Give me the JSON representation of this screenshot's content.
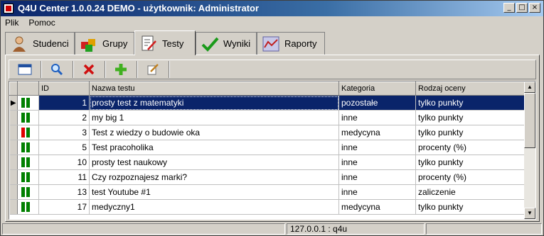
{
  "window": {
    "title": "Q4U Center 1.0.0.24 DEMO - użytkownik: Administrator",
    "minimize": "_",
    "maximize": "□",
    "close": "×"
  },
  "menu": [
    {
      "label": "Plik"
    },
    {
      "label": "Pomoc"
    }
  ],
  "tabs": [
    {
      "label": "Studenci",
      "icon": "student-icon"
    },
    {
      "label": "Grupy",
      "icon": "groups-icon"
    },
    {
      "label": "Testy",
      "icon": "tests-icon",
      "active": true
    },
    {
      "label": "Wyniki",
      "icon": "results-check-icon"
    },
    {
      "label": "Raporty",
      "icon": "reports-chart-icon"
    }
  ],
  "toolbar": [
    {
      "name": "open-button",
      "icon": "window-icon"
    },
    {
      "name": "search-button",
      "icon": "magnifier-icon"
    },
    {
      "name": "delete-button",
      "icon": "red-x-icon"
    },
    {
      "name": "add-button",
      "icon": "green-plus-icon"
    },
    {
      "name": "edit-button",
      "icon": "pencil-note-icon"
    }
  ],
  "grid": {
    "headers": {
      "id": "ID",
      "name": "Nazwa testu",
      "category": "Kategoria",
      "grade_type": "Rodzaj oceny"
    },
    "selected_row": 0,
    "rows": [
      {
        "id": "1",
        "name": "prosty test z matematyki",
        "category": "pozostałe",
        "grade_type": "tylko punkty",
        "status": [
          "#008000",
          "#008000"
        ]
      },
      {
        "id": "2",
        "name": "my big 1",
        "category": "inne",
        "grade_type": "tylko punkty",
        "status": [
          "#008000",
          "#008000"
        ]
      },
      {
        "id": "3",
        "name": "Test z wiedzy o budowie oka",
        "category": "medycyna",
        "grade_type": "tylko punkty",
        "status": [
          "#e00000",
          "#008000"
        ]
      },
      {
        "id": "5",
        "name": "Test pracoholika",
        "category": "inne",
        "grade_type": "procenty (%)",
        "status": [
          "#008000",
          "#008000"
        ]
      },
      {
        "id": "10",
        "name": "prosty test naukowy",
        "category": "inne",
        "grade_type": "tylko punkty",
        "status": [
          "#008000",
          "#008000"
        ]
      },
      {
        "id": "11",
        "name": "Czy rozpoznajesz marki?",
        "category": "inne",
        "grade_type": "procenty (%)",
        "status": [
          "#008000",
          "#008000"
        ]
      },
      {
        "id": "13",
        "name": "test Youtube #1",
        "category": "inne",
        "grade_type": "zaliczenie",
        "status": [
          "#008000",
          "#008000"
        ]
      },
      {
        "id": "17",
        "name": "medyczny1",
        "category": "medycyna",
        "grade_type": "tylko punkty",
        "status": [
          "#008000",
          "#008000"
        ]
      }
    ]
  },
  "status": {
    "left": "",
    "server": "127.0.0.1 : q4u",
    "right": ""
  },
  "colors": {
    "selection": "#0a246a",
    "titlebar": "#0a246a",
    "face": "#d4d0c8"
  }
}
